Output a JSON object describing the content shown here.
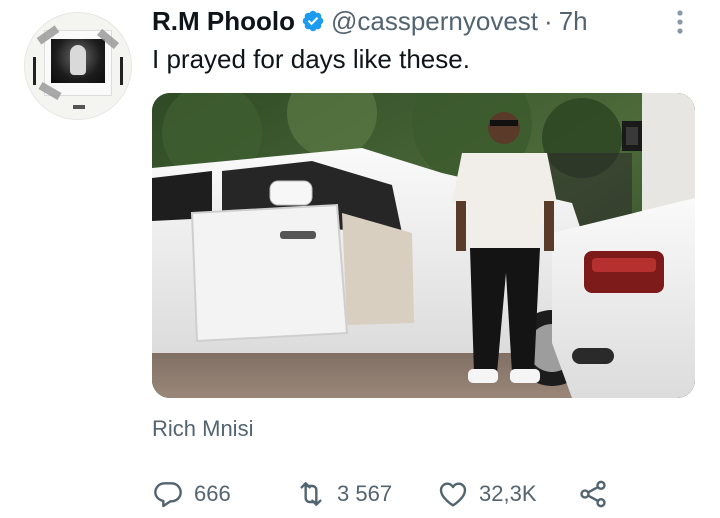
{
  "tweet": {
    "display_name": "R.M Phoolo",
    "handle": "@casspernyovest",
    "separator": "·",
    "time": "7h",
    "text": "I prayed for days like these.",
    "photo_credit": "Rich Mnisi",
    "verified": true
  },
  "icons": {
    "avatar": "framed-photo-avatar",
    "verified": "verified-badge-icon",
    "more": "more-vertical-icon",
    "reply": "reply-icon",
    "retweet": "retweet-icon",
    "like": "heart-icon",
    "share": "share-icon"
  },
  "actions": {
    "reply_count": "666",
    "retweet_count": "3 567",
    "like_count": "32,3K"
  },
  "colors": {
    "text_primary": "#0f1419",
    "text_secondary": "#536471",
    "verified_blue": "#1d9bf0"
  }
}
